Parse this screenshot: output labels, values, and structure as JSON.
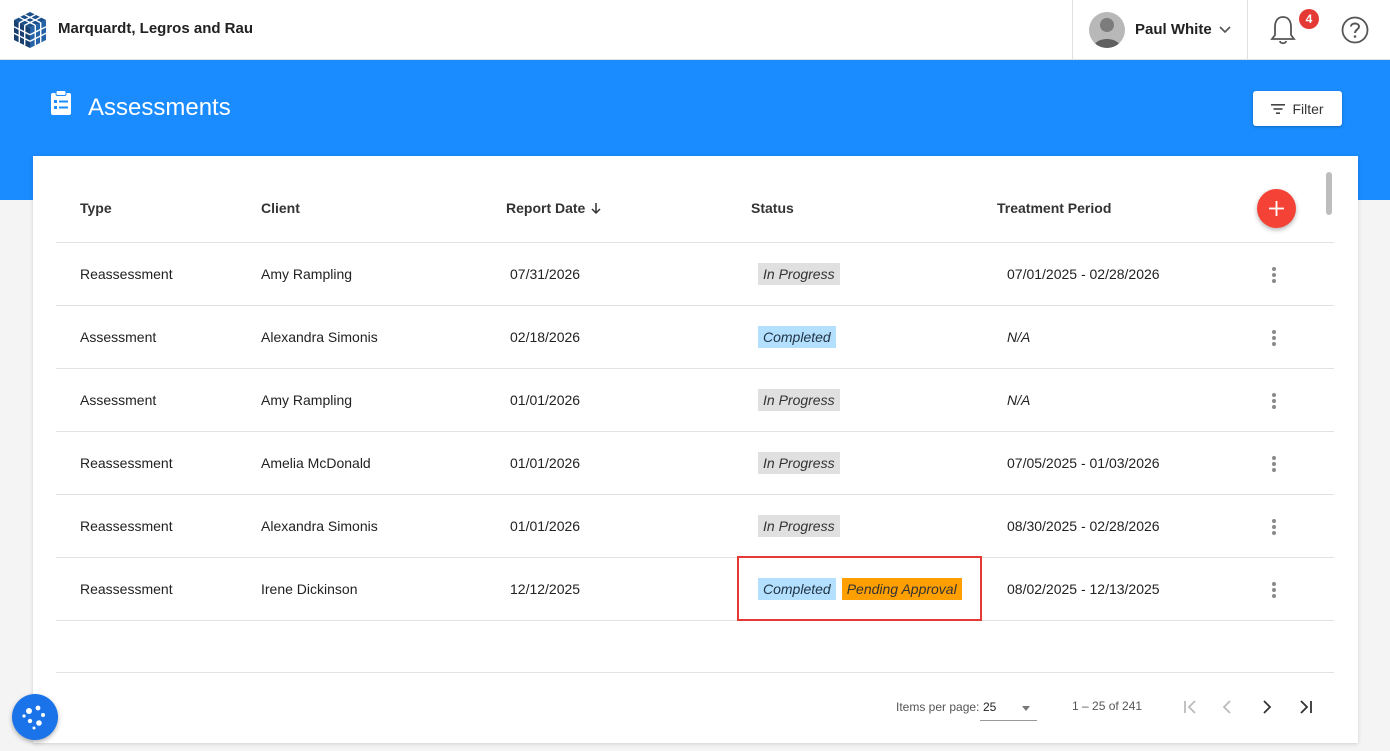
{
  "topbar": {
    "org_name": "Marquardt, Legros and Rau",
    "user_name": "Paul White",
    "notification_count": "4"
  },
  "page": {
    "title": "Assessments",
    "filter_label": "Filter"
  },
  "table": {
    "headers": {
      "type": "Type",
      "client": "Client",
      "report_date": "Report Date",
      "status": "Status",
      "treatment_period": "Treatment Period"
    },
    "rows": [
      {
        "type": "Reassessment",
        "client": "Amy Rampling",
        "report_date": "07/31/2026",
        "status": "In Progress",
        "treatment_period": "07/01/2025 - 02/28/2026"
      },
      {
        "type": "Assessment",
        "client": "Alexandra Simonis",
        "report_date": "02/18/2026",
        "status": "Completed",
        "treatment_period": "N/A"
      },
      {
        "type": "Assessment",
        "client": "Amy Rampling",
        "report_date": "01/01/2026",
        "status": "In Progress",
        "treatment_period": "N/A"
      },
      {
        "type": "Reassessment",
        "client": "Amelia McDonald",
        "report_date": "01/01/2026",
        "status": "In Progress",
        "treatment_period": "07/05/2025 - 01/03/2026"
      },
      {
        "type": "Reassessment",
        "client": "Alexandra Simonis",
        "report_date": "01/01/2026",
        "status": "In Progress",
        "treatment_period": "08/30/2025 - 02/28/2026"
      },
      {
        "type": "Reassessment",
        "client": "Irene Dickinson",
        "report_date": "12/12/2025",
        "status": "Completed",
        "status_extra": "Pending Approval",
        "treatment_period": "08/02/2025 - 12/13/2025"
      }
    ]
  },
  "paginator": {
    "items_per_page_label": "Items per page:",
    "items_per_page_value": "25",
    "range_label": "1 – 25 of 241"
  },
  "colors": {
    "banner": "#1a8cff",
    "add_button": "#f44336",
    "badge_in_progress": "#e0e0e0",
    "badge_completed": "#b3e0ff",
    "badge_pending": "#ffa000",
    "highlight": "#e53935"
  },
  "icons": [
    "cube-logo-icon",
    "chevron-down-icon",
    "bell-icon",
    "help-icon",
    "clipboard-list-icon",
    "filter-icon",
    "arrow-down-icon",
    "plus-icon",
    "more-vert-icon",
    "first-page-icon",
    "prev-page-icon",
    "next-page-icon",
    "last-page-icon",
    "cookie-icon"
  ]
}
